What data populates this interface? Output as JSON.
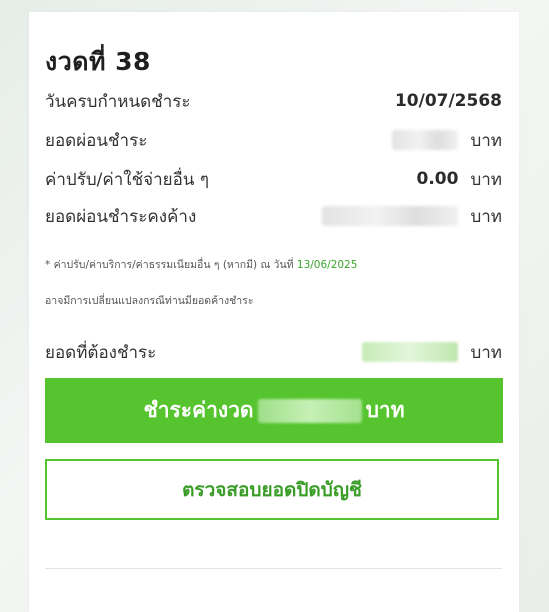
{
  "installment": {
    "title": "งวดที่ 38",
    "rows": [
      {
        "label": "วันครบกำหนดชำระ",
        "value": "10/07/2568",
        "unit": ""
      },
      {
        "label": "ยอดผ่อนชำระ",
        "value": "",
        "unit": "บาท"
      },
      {
        "label": "ค่าปรับ/ค่าใช้จ่ายอื่น ๆ",
        "value": "0.00",
        "unit": "บาท"
      },
      {
        "label": "ยอดผ่อนชำระคงค้าง",
        "value": "",
        "unit": "บาท"
      }
    ],
    "note1_prefix": "* ค่าปรับ/ค่าบริการ/ค่าธรรมเนียมอื่น ๆ (หากมี) ณ วันที่",
    "note1_date": "13/06/2025",
    "note2": "อาจมีการเปลี่ยนแปลงกรณีท่านมียอดค้างชำระ",
    "due_label": "ยอดที่ต้องชำระ",
    "due_unit": "บาท"
  },
  "buttons": {
    "pay_prefix": "ชำระค่างวด",
    "pay_suffix": "บาท",
    "check_label": "ตรวจสอบยอดปิดบัญชี"
  },
  "colors": {
    "accent_green": "#55c42e",
    "date_green": "#3aa62c"
  }
}
